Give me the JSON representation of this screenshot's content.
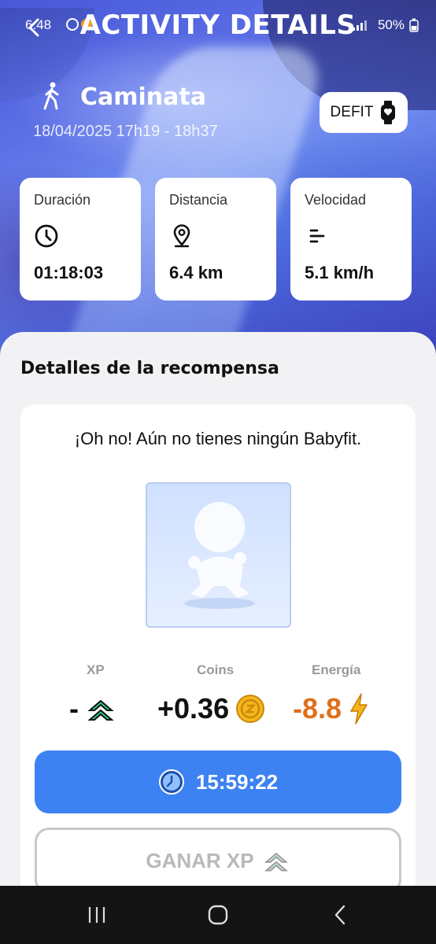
{
  "status_bar": {
    "time": "6:48",
    "battery": "50%"
  },
  "header": {
    "title": "ACTIVITY DETAILS"
  },
  "activity": {
    "name": "Caminata",
    "date_range": "18/04/2025 17h19 - 18h37",
    "device_label": "DEFIT"
  },
  "stats": [
    {
      "label": "Duración",
      "value": "01:18:03",
      "icon": "clock-icon"
    },
    {
      "label": "Distancia",
      "value": "6.4 km",
      "icon": "location-pin-icon"
    },
    {
      "label": "Velocidad",
      "value": "5.1 km/h",
      "icon": "speed-lines-icon"
    }
  ],
  "reward": {
    "section_title": "Detalles de la recompensa",
    "message": "¡Oh no! Aún no tienes ningún Babyfit.",
    "metrics": {
      "xp": {
        "label": "XP",
        "value": "-"
      },
      "coins": {
        "label": "Coins",
        "value": "+0.36"
      },
      "energy": {
        "label": "Energía",
        "value": "-8.8"
      }
    },
    "timer": "15:59:22",
    "xp_button_label": "GANAR XP"
  },
  "colors": {
    "accent_blue": "#3d82f2",
    "energy_orange": "#e0701a",
    "xp_green": "#2fcf86",
    "coin_gold": "#f5b51e"
  }
}
